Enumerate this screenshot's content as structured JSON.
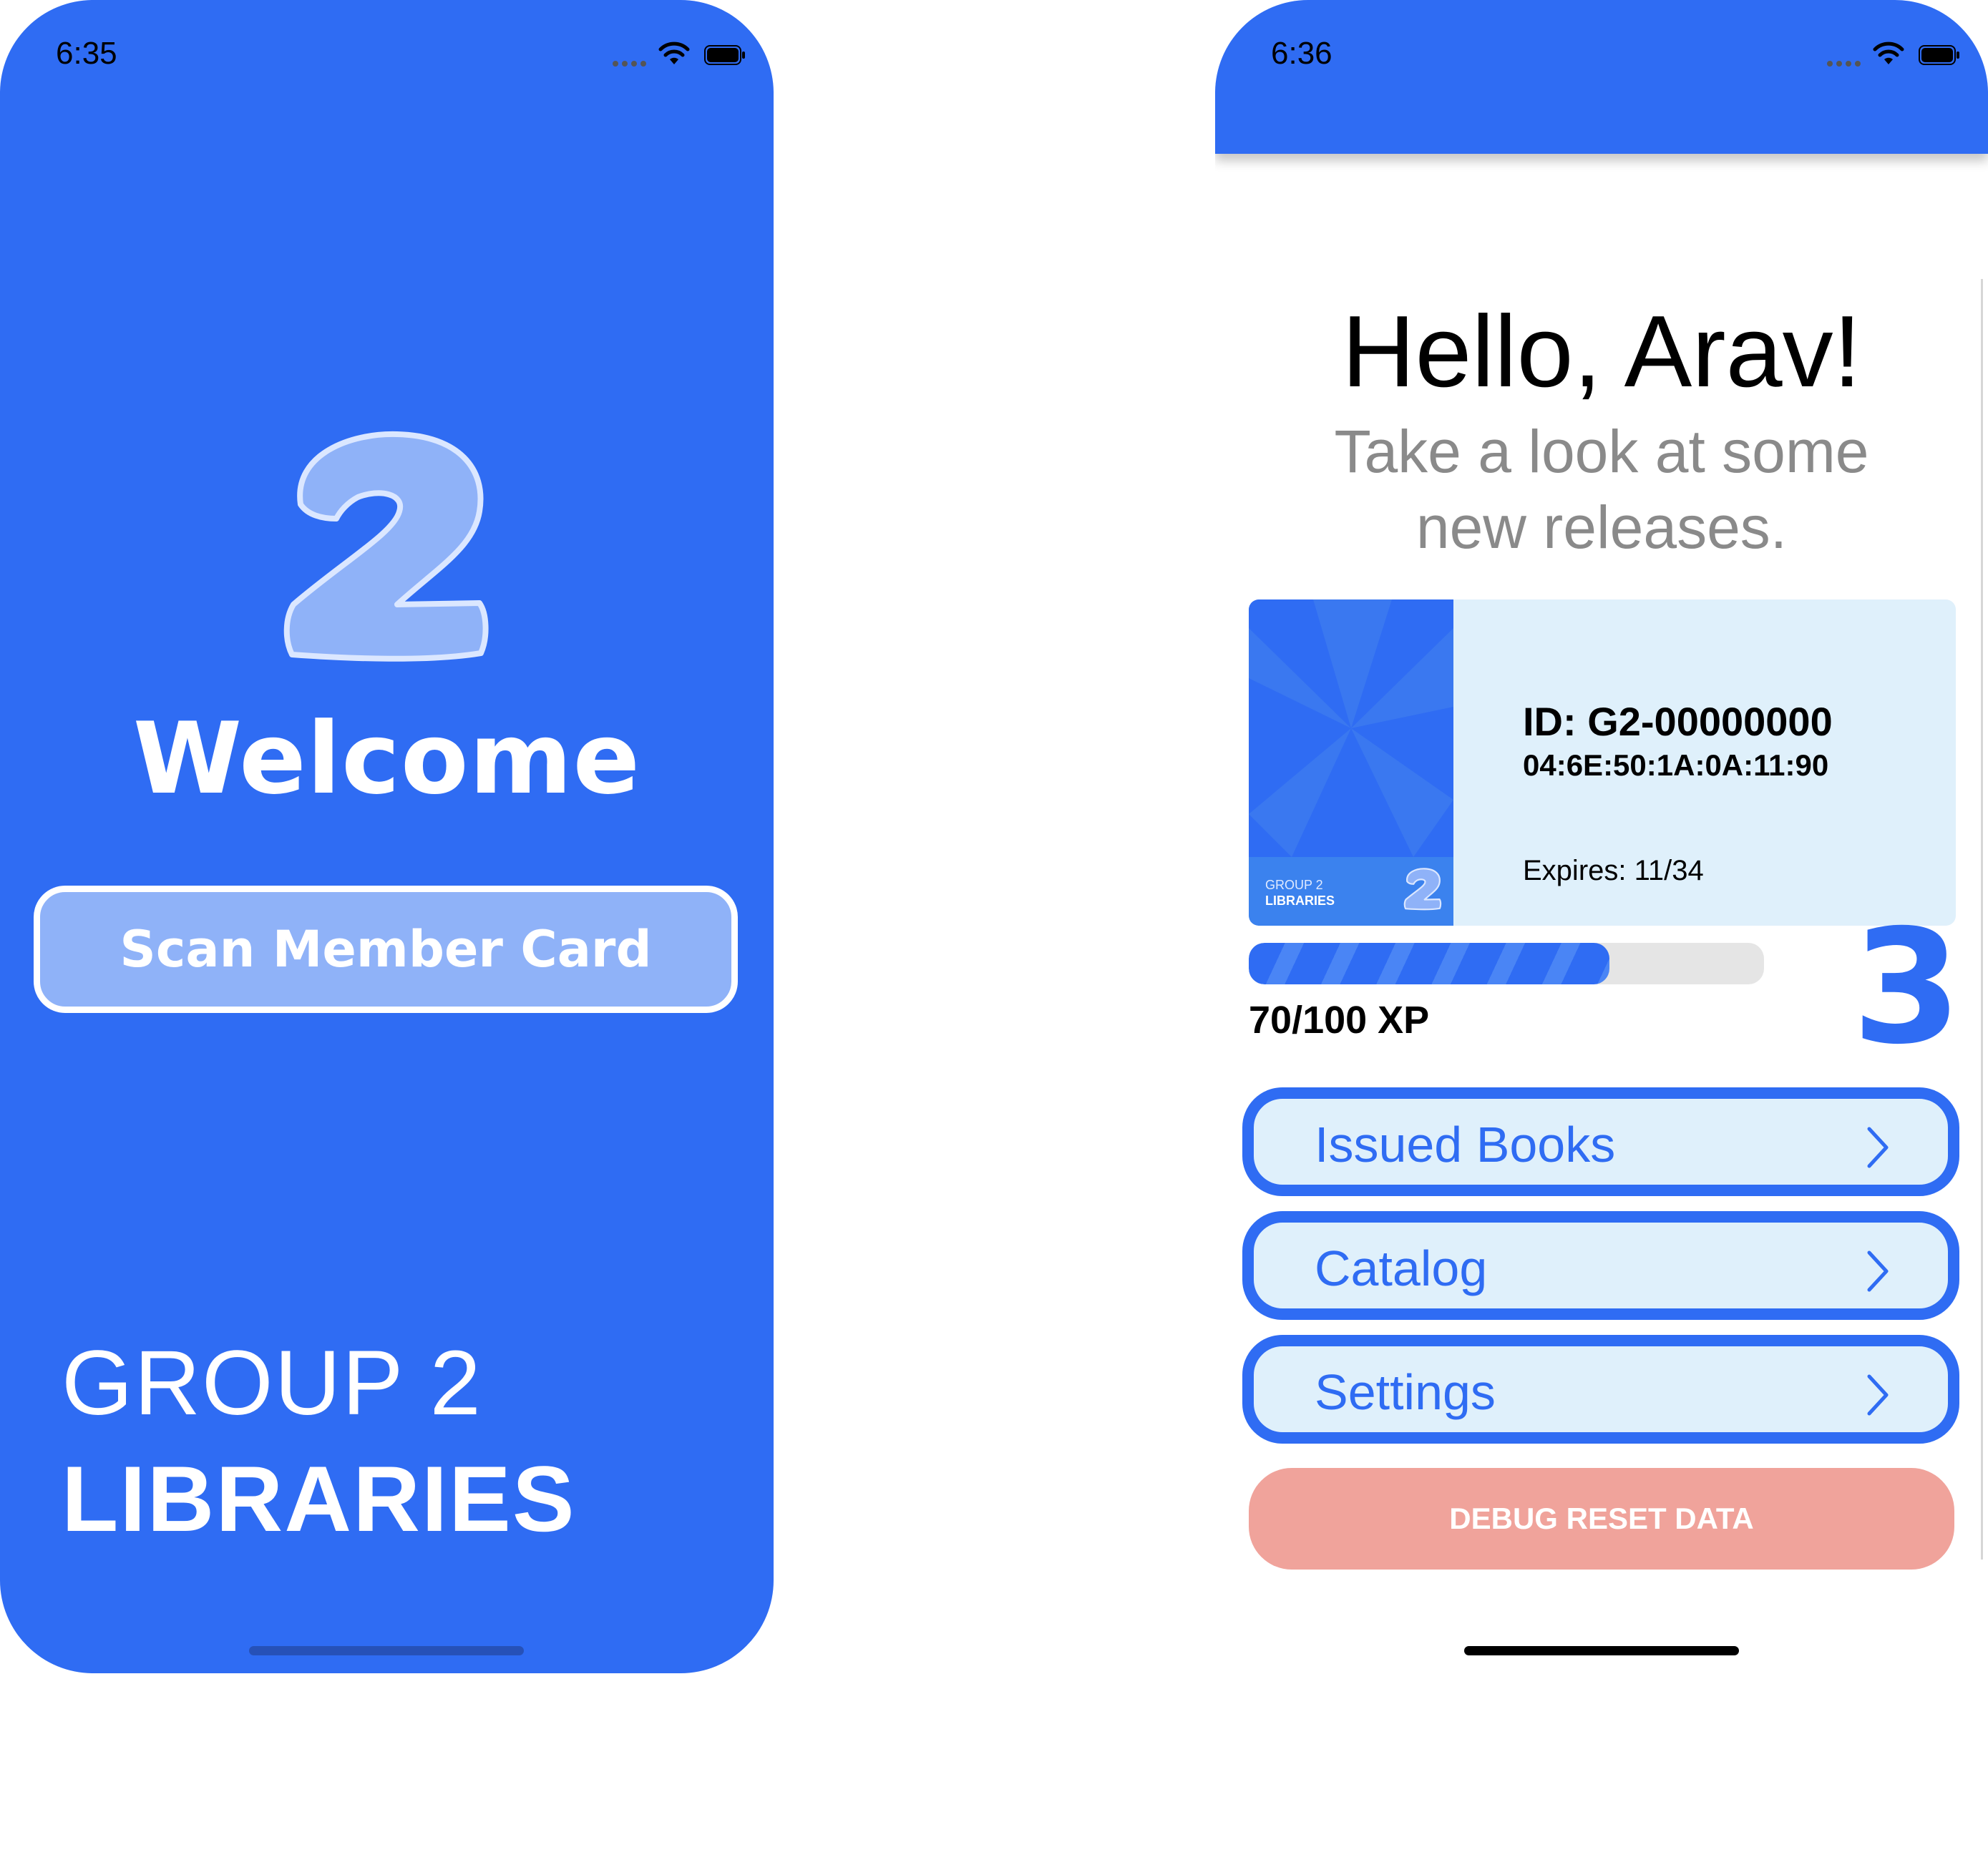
{
  "left_screen": {
    "status_time": "6:35",
    "welcome_title": "Welcome",
    "scan_button_label": "Scan Member Card",
    "brand_line1": "GROUP 2",
    "brand_line2": "LIBRARIES"
  },
  "right_screen": {
    "status_time": "6:36",
    "greeting": "Hello, Arav!",
    "subtitle_line1": "Take a look at some",
    "subtitle_line2": "new releases.",
    "member_card": {
      "id_text": "ID: G2-00000000",
      "mac_text": "04:6E:50:1A:0A:11:90",
      "expires_text": "Expires: 11/34",
      "logo_line1": "GROUP 2",
      "logo_line2": "LIBRARIES"
    },
    "xp": {
      "current": 70,
      "max": 100,
      "label": "70/100 XP"
    },
    "level": "3",
    "menu": [
      {
        "label": "Issued Books"
      },
      {
        "label": "Catalog"
      },
      {
        "label": "Settings"
      }
    ],
    "debug_button_label": "DEBUG RESET DATA"
  },
  "colors": {
    "brand_blue": "#2f6cf3",
    "light_blue": "#dff0fb",
    "scan_button_fill": "#8fb2f8",
    "debug_red": "#f0a39b"
  },
  "icons": [
    "wifi-icon",
    "battery-icon",
    "signal-dots-icon",
    "chevron-right-icon",
    "two-logo-icon"
  ]
}
